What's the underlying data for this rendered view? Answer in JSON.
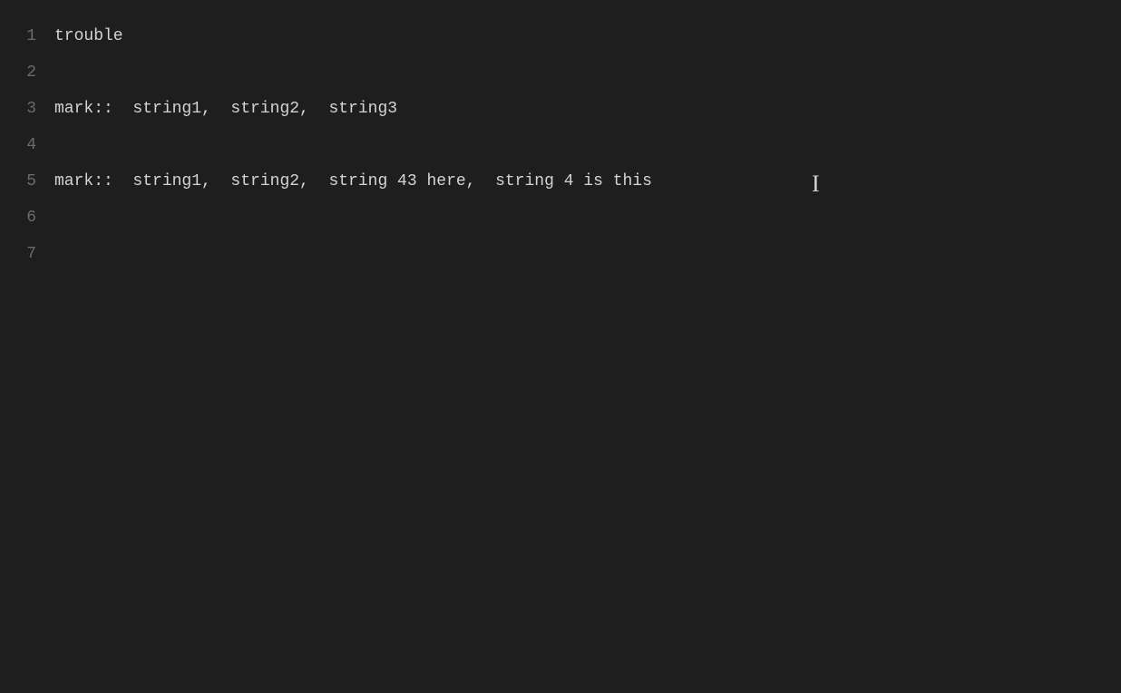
{
  "editor": {
    "background": "#1e1e1e",
    "lines": [
      {
        "number": "1",
        "content": "trouble"
      },
      {
        "number": "2",
        "content": ""
      },
      {
        "number": "3",
        "content": "mark::  string1,  string2,  string3"
      },
      {
        "number": "4",
        "content": ""
      },
      {
        "number": "5",
        "content": "mark::  string1,  string2,  string 43 here,  string 4 is this"
      },
      {
        "number": "6",
        "content": ""
      },
      {
        "number": "7",
        "content": ""
      }
    ]
  }
}
